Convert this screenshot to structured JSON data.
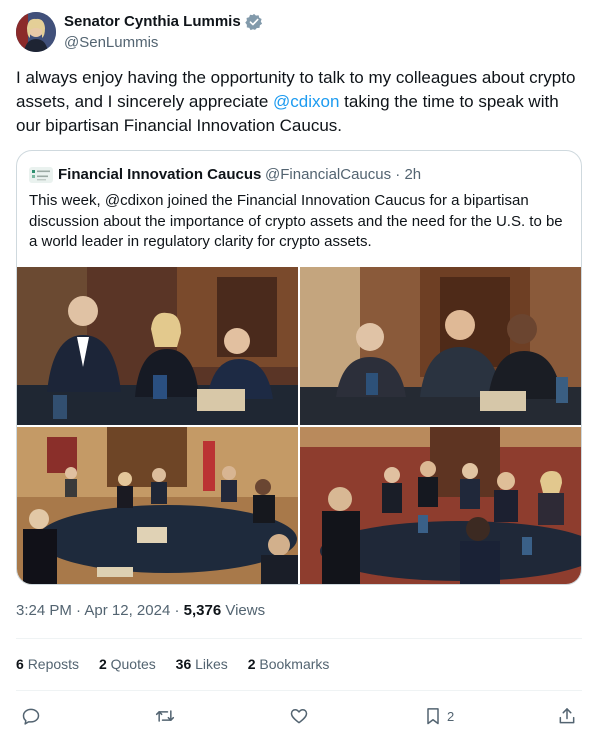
{
  "author": {
    "name": "Senator Cynthia Lummis",
    "handle": "@SenLummis"
  },
  "tweet": {
    "text_before": "I always enjoy having the opportunity to talk to my colleagues about crypto assets, and I sincerely appreciate ",
    "mention": "@cdixon",
    "text_after": " taking the time to speak with our bipartisan Financial Innovation Caucus."
  },
  "quote": {
    "name": "Financial Innovation Caucus",
    "handle": "@FinancialCaucus",
    "separator": "·",
    "age": "2h",
    "text": "This week, @cdixon joined the Financial Innovation Caucus for a bipartisan discussion about the importance of crypto assets and the need for the U.S. to be a world leader in regulatory clarity for crypto assets."
  },
  "meta": {
    "time": "3:24 PM",
    "separator": "·",
    "date": "Apr 12, 2024",
    "views_count": "5,376",
    "views_label": "Views"
  },
  "stats": {
    "reposts_count": "6",
    "reposts_label": "Reposts",
    "quotes_count": "2",
    "quotes_label": "Quotes",
    "likes_count": "36",
    "likes_label": "Likes",
    "bookmarks_count": "2",
    "bookmarks_label": "Bookmarks"
  },
  "actions": {
    "bookmark_count": "2"
  },
  "colors": {
    "accent": "#1d9bf0",
    "secondary_text": "#536471",
    "border": "#cfd9de"
  },
  "icons": [
    "verified-badge-icon",
    "reply-icon",
    "repost-icon",
    "like-icon",
    "bookmark-icon",
    "share-icon"
  ]
}
